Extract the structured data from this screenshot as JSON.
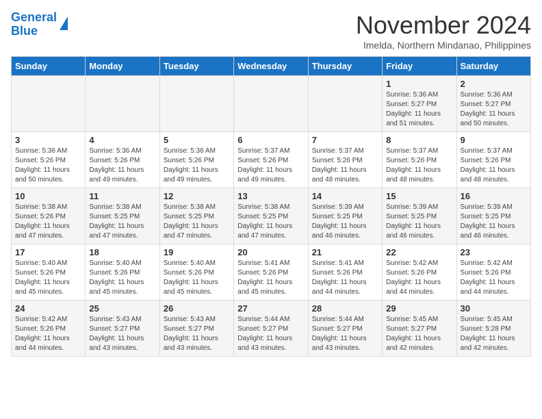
{
  "logo": {
    "line1": "General",
    "line2": "Blue"
  },
  "header": {
    "month": "November 2024",
    "location": "Imelda, Northern Mindanao, Philippines"
  },
  "weekdays": [
    "Sunday",
    "Monday",
    "Tuesday",
    "Wednesday",
    "Thursday",
    "Friday",
    "Saturday"
  ],
  "weeks": [
    [
      {
        "day": "",
        "info": ""
      },
      {
        "day": "",
        "info": ""
      },
      {
        "day": "",
        "info": ""
      },
      {
        "day": "",
        "info": ""
      },
      {
        "day": "",
        "info": ""
      },
      {
        "day": "1",
        "info": "Sunrise: 5:36 AM\nSunset: 5:27 PM\nDaylight: 11 hours\nand 51 minutes."
      },
      {
        "day": "2",
        "info": "Sunrise: 5:36 AM\nSunset: 5:27 PM\nDaylight: 11 hours\nand 50 minutes."
      }
    ],
    [
      {
        "day": "3",
        "info": "Sunrise: 5:36 AM\nSunset: 5:26 PM\nDaylight: 11 hours\nand 50 minutes."
      },
      {
        "day": "4",
        "info": "Sunrise: 5:36 AM\nSunset: 5:26 PM\nDaylight: 11 hours\nand 49 minutes."
      },
      {
        "day": "5",
        "info": "Sunrise: 5:36 AM\nSunset: 5:26 PM\nDaylight: 11 hours\nand 49 minutes."
      },
      {
        "day": "6",
        "info": "Sunrise: 5:37 AM\nSunset: 5:26 PM\nDaylight: 11 hours\nand 49 minutes."
      },
      {
        "day": "7",
        "info": "Sunrise: 5:37 AM\nSunset: 5:26 PM\nDaylight: 11 hours\nand 48 minutes."
      },
      {
        "day": "8",
        "info": "Sunrise: 5:37 AM\nSunset: 5:26 PM\nDaylight: 11 hours\nand 48 minutes."
      },
      {
        "day": "9",
        "info": "Sunrise: 5:37 AM\nSunset: 5:26 PM\nDaylight: 11 hours\nand 48 minutes."
      }
    ],
    [
      {
        "day": "10",
        "info": "Sunrise: 5:38 AM\nSunset: 5:26 PM\nDaylight: 11 hours\nand 47 minutes."
      },
      {
        "day": "11",
        "info": "Sunrise: 5:38 AM\nSunset: 5:25 PM\nDaylight: 11 hours\nand 47 minutes."
      },
      {
        "day": "12",
        "info": "Sunrise: 5:38 AM\nSunset: 5:25 PM\nDaylight: 11 hours\nand 47 minutes."
      },
      {
        "day": "13",
        "info": "Sunrise: 5:38 AM\nSunset: 5:25 PM\nDaylight: 11 hours\nand 47 minutes."
      },
      {
        "day": "14",
        "info": "Sunrise: 5:39 AM\nSunset: 5:25 PM\nDaylight: 11 hours\nand 46 minutes."
      },
      {
        "day": "15",
        "info": "Sunrise: 5:39 AM\nSunset: 5:25 PM\nDaylight: 11 hours\nand 46 minutes."
      },
      {
        "day": "16",
        "info": "Sunrise: 5:39 AM\nSunset: 5:25 PM\nDaylight: 11 hours\nand 46 minutes."
      }
    ],
    [
      {
        "day": "17",
        "info": "Sunrise: 5:40 AM\nSunset: 5:26 PM\nDaylight: 11 hours\nand 45 minutes."
      },
      {
        "day": "18",
        "info": "Sunrise: 5:40 AM\nSunset: 5:26 PM\nDaylight: 11 hours\nand 45 minutes."
      },
      {
        "day": "19",
        "info": "Sunrise: 5:40 AM\nSunset: 5:26 PM\nDaylight: 11 hours\nand 45 minutes."
      },
      {
        "day": "20",
        "info": "Sunrise: 5:41 AM\nSunset: 5:26 PM\nDaylight: 11 hours\nand 45 minutes."
      },
      {
        "day": "21",
        "info": "Sunrise: 5:41 AM\nSunset: 5:26 PM\nDaylight: 11 hours\nand 44 minutes."
      },
      {
        "day": "22",
        "info": "Sunrise: 5:42 AM\nSunset: 5:26 PM\nDaylight: 11 hours\nand 44 minutes."
      },
      {
        "day": "23",
        "info": "Sunrise: 5:42 AM\nSunset: 5:26 PM\nDaylight: 11 hours\nand 44 minutes."
      }
    ],
    [
      {
        "day": "24",
        "info": "Sunrise: 5:42 AM\nSunset: 5:26 PM\nDaylight: 11 hours\nand 44 minutes."
      },
      {
        "day": "25",
        "info": "Sunrise: 5:43 AM\nSunset: 5:27 PM\nDaylight: 11 hours\nand 43 minutes."
      },
      {
        "day": "26",
        "info": "Sunrise: 5:43 AM\nSunset: 5:27 PM\nDaylight: 11 hours\nand 43 minutes."
      },
      {
        "day": "27",
        "info": "Sunrise: 5:44 AM\nSunset: 5:27 PM\nDaylight: 11 hours\nand 43 minutes."
      },
      {
        "day": "28",
        "info": "Sunrise: 5:44 AM\nSunset: 5:27 PM\nDaylight: 11 hours\nand 43 minutes."
      },
      {
        "day": "29",
        "info": "Sunrise: 5:45 AM\nSunset: 5:27 PM\nDaylight: 11 hours\nand 42 minutes."
      },
      {
        "day": "30",
        "info": "Sunrise: 5:45 AM\nSunset: 5:28 PM\nDaylight: 11 hours\nand 42 minutes."
      }
    ]
  ]
}
